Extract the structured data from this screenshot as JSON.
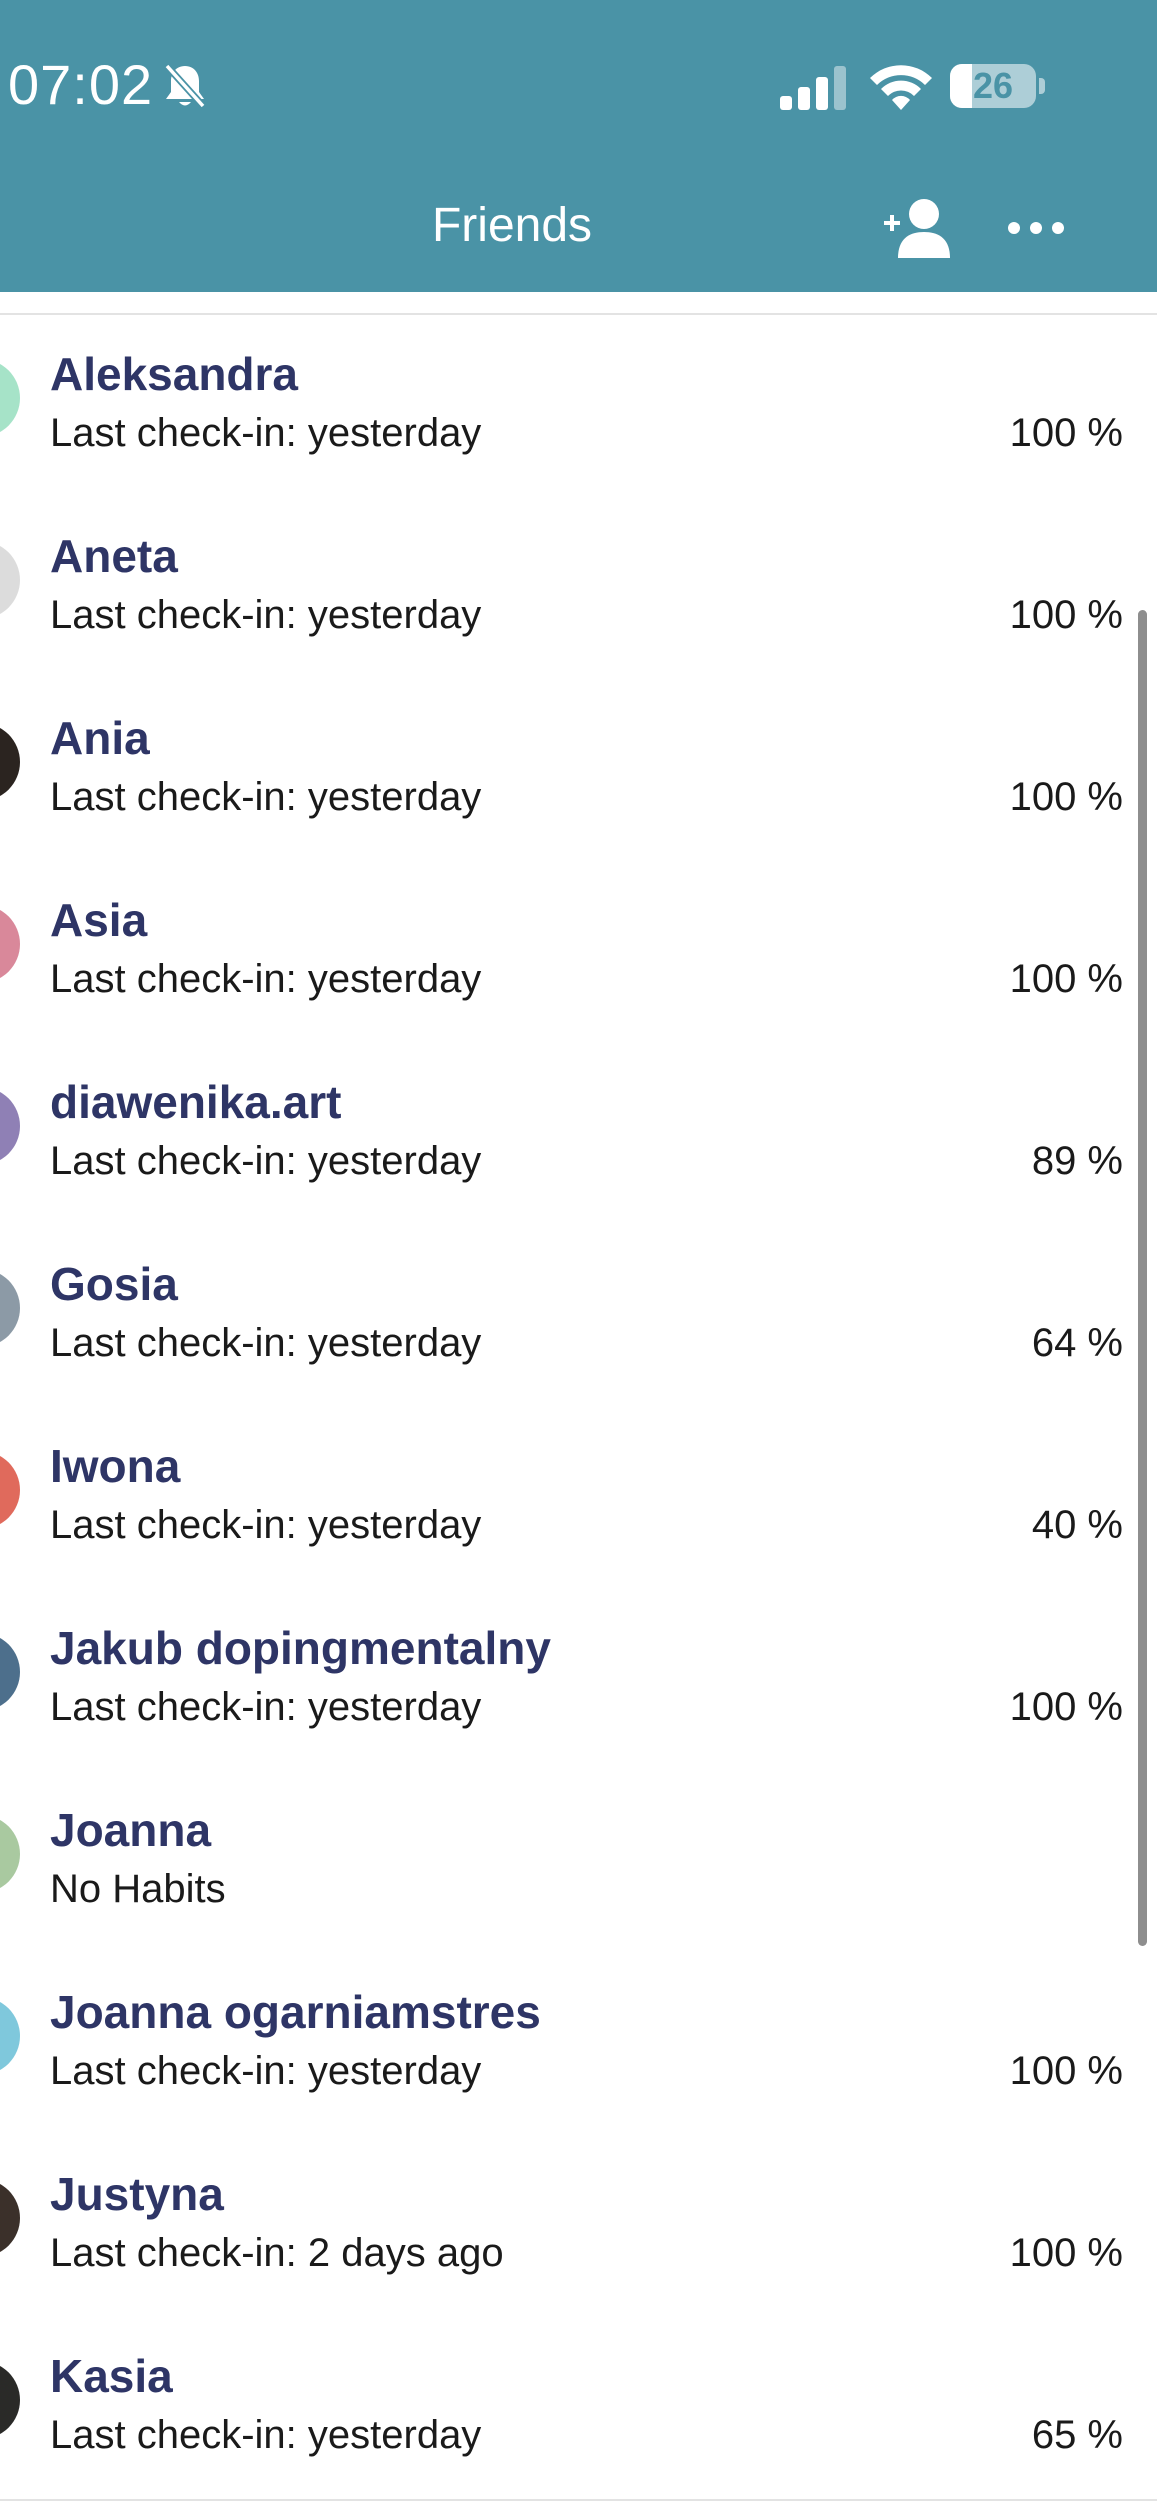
{
  "status_bar": {
    "time": "07:02",
    "battery_level": "26",
    "battery_fraction": 0.26,
    "icons": [
      "bell-slash-icon",
      "signal-icon",
      "wifi-icon",
      "battery-icon"
    ]
  },
  "header": {
    "title": "Friends",
    "background_color": "#4a93a6",
    "actions": [
      "add-friend-icon",
      "more-horizontal-icon"
    ]
  },
  "friends": [
    {
      "name": "Aleksandra",
      "status": "Last check-in: yesterday",
      "percent": "100 %",
      "avatar_color": "#a6e3c8"
    },
    {
      "name": "Aneta",
      "status": "Last check-in: yesterday",
      "percent": "100 %",
      "avatar_color": "#dcdcdc"
    },
    {
      "name": "Ania",
      "status": "Last check-in: yesterday",
      "percent": "100 %",
      "avatar_color": "#2b2420"
    },
    {
      "name": "Asia",
      "status": "Last check-in: yesterday",
      "percent": "100 %",
      "avatar_color": "#d9889a"
    },
    {
      "name": "diawenika.art",
      "status": "Last check-in: yesterday",
      "percent": "89 %",
      "avatar_color": "#8f80b5"
    },
    {
      "name": "Gosia",
      "status": "Last check-in: yesterday",
      "percent": "64 %",
      "avatar_color": "#8c9aa6"
    },
    {
      "name": "Iwona",
      "status": "Last check-in: yesterday",
      "percent": "40 %",
      "avatar_color": "#e06a5c"
    },
    {
      "name": "Jakub dopingmentalny",
      "status": "Last check-in: yesterday",
      "percent": "100 %",
      "avatar_color": "#4d6f8c"
    },
    {
      "name": "Joanna",
      "status": "No Habits",
      "percent": "",
      "avatar_color": "#a9c9a0"
    },
    {
      "name": "Joanna ogarniamstres",
      "status": "Last check-in: yesterday",
      "percent": "100 %",
      "avatar_color": "#7fc8dc"
    },
    {
      "name": "Justyna",
      "status": "Last check-in: 2 days ago",
      "percent": "100 %",
      "avatar_color": "#3b302a"
    },
    {
      "name": "Kasia",
      "status": "Last check-in: yesterday",
      "percent": "65 %",
      "avatar_color": "#2a2a28"
    }
  ],
  "colors": {
    "name_text": "#2e3566",
    "body_text": "#1a1a1a",
    "divider": "#e3e3e3"
  }
}
